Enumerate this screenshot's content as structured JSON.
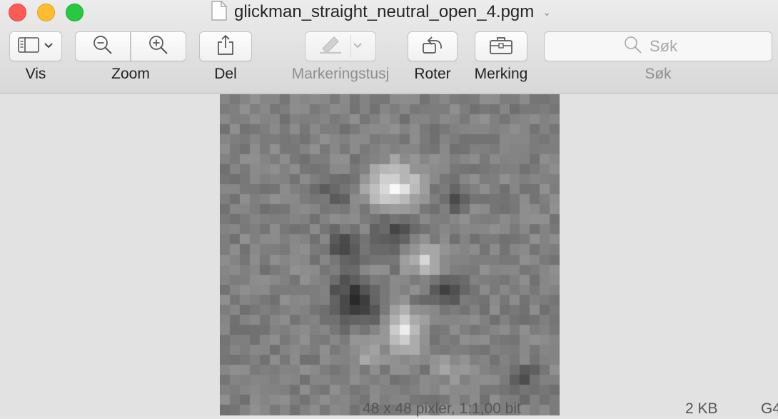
{
  "window": {
    "title": "glickman_straight_neutral_open_4.pgm",
    "buttons": {
      "close": "close",
      "minimize": "minimize",
      "maximize": "maximize"
    }
  },
  "toolbar": {
    "vis": {
      "label": "Vis",
      "icon": "sidebar-icon"
    },
    "zoom": {
      "label": "Zoom",
      "icons": [
        "zoom-out-icon",
        "zoom-in-icon"
      ]
    },
    "del": {
      "label": "Del",
      "icon": "share-icon"
    },
    "markering": {
      "label": "Markeringstusj",
      "icon": "marker-pen-icon",
      "enabled": false
    },
    "roter": {
      "label": "Roter",
      "icon": "rotate-icon"
    },
    "merking": {
      "label": "Merking",
      "icon": "toolbox-icon"
    },
    "search": {
      "label": "Søk",
      "placeholder": "Søk"
    }
  },
  "status": {
    "info": "48 x 48 pixler, 1:1,00 bit",
    "size": "2 KB",
    "extra": "G4"
  },
  "image": {
    "alt": "Grayscale pixelated PGM image",
    "columns": 34,
    "rows": 32
  },
  "colors": {
    "toolbar_bg": "#e0e0e0",
    "content_bg": "#e2e2e2",
    "close": "#fc5b57",
    "minimize": "#febc2e",
    "maximize": "#28c840"
  }
}
